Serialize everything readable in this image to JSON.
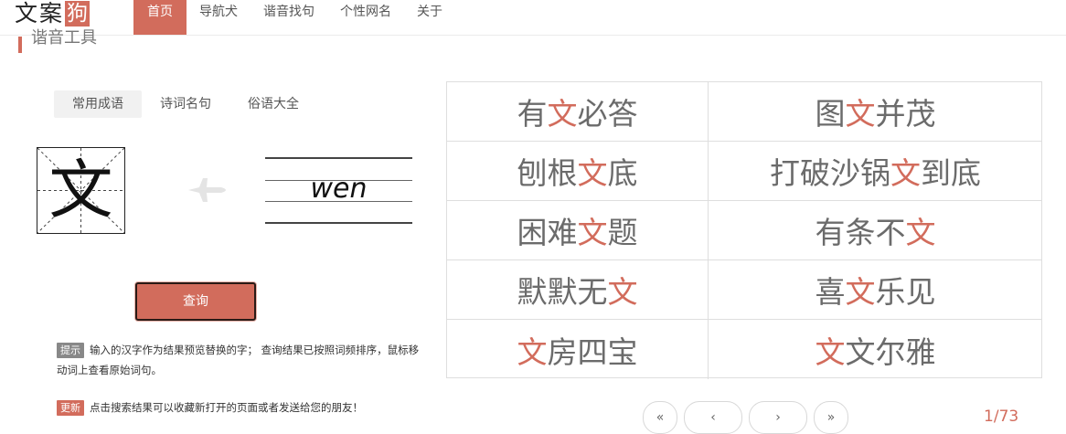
{
  "logo": {
    "text": "文案",
    "box": "狗"
  },
  "nav": {
    "items": [
      {
        "label": "首页",
        "active": true
      },
      {
        "label": "导航犬",
        "active": false
      },
      {
        "label": "谐音找句",
        "active": false
      },
      {
        "label": "个性网名",
        "active": false
      },
      {
        "label": "关于",
        "active": false
      }
    ]
  },
  "section": {
    "title": "谐音工具"
  },
  "tabs": [
    {
      "label": "常用成语",
      "active": true
    },
    {
      "label": "诗词名句",
      "active": false
    },
    {
      "label": "俗语大全",
      "active": false
    }
  ],
  "character": {
    "glyph": "文",
    "pinyin": "wen"
  },
  "query_button": {
    "label": "查询"
  },
  "tips": {
    "hint_badge": "提示",
    "hint_text": "输入的汉字作为结果预览替换的字； 查询结果已按照词频排序，鼠标移动词上查看原始词句。",
    "update_badge": "更新",
    "update_text": "点击搜索结果可以收藏新打开的页面或者发送给您的朋友！"
  },
  "results": [
    {
      "pre": "有",
      "hl": "文",
      "post": "必答"
    },
    {
      "pre": "图",
      "hl": "文",
      "post": "并茂"
    },
    {
      "pre": "刨根",
      "hl": "文",
      "post": "底"
    },
    {
      "pre": "打破沙锅",
      "hl": "文",
      "post": "到底"
    },
    {
      "pre": "困难",
      "hl": "文",
      "post": "题"
    },
    {
      "pre": "有条不",
      "hl": "文",
      "post": ""
    },
    {
      "pre": "默默无",
      "hl": "文",
      "post": ""
    },
    {
      "pre": "喜",
      "hl": "文",
      "post": "乐见"
    },
    {
      "pre": "",
      "hl": "文",
      "post": "房四宝"
    },
    {
      "pre": "",
      "hl": "文",
      "post": "文尔雅"
    }
  ],
  "pagination": {
    "first": "«",
    "prev": "‹",
    "next": "›",
    "last": "»",
    "current": "1",
    "separator": "/",
    "total": "73"
  },
  "colors": {
    "accent": "#d26c5c",
    "text_gray": "#6b6b6b",
    "border": "#dedede"
  }
}
